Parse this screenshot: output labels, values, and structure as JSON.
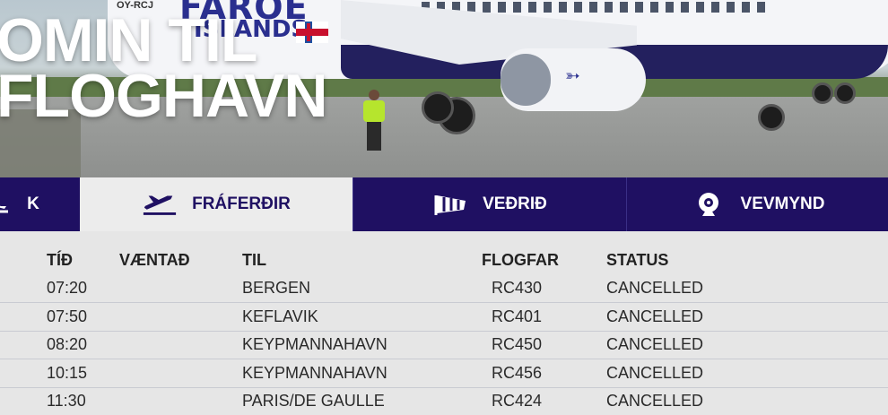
{
  "hero": {
    "title_line1": "OMIN TIL",
    "title_line2": "FLOGHAVN",
    "plane_brand_line1": "FAROE",
    "plane_brand_line2": "ISLANDS",
    "plane_registration": "OY-RCJ"
  },
  "nav": {
    "tabs": [
      {
        "label": "K",
        "icon": "landing-plane-icon",
        "active": false
      },
      {
        "label": "FRÁFERÐIR",
        "icon": "departing-plane-icon",
        "active": true
      },
      {
        "label": "VEÐRIÐ",
        "icon": "windsock-icon",
        "active": false
      },
      {
        "label": "VEVMYND",
        "icon": "webcam-icon",
        "active": false
      }
    ]
  },
  "table": {
    "headers": {
      "time": "TÍÐ",
      "expected": "VÆNTAÐ",
      "to": "TIL",
      "flight": "FLOGFAR",
      "status": "STATUS"
    },
    "rows": [
      {
        "time": "07:20",
        "expected": "",
        "to": "BERGEN",
        "flight": "RC430",
        "status": "CANCELLED"
      },
      {
        "time": "07:50",
        "expected": "",
        "to": "KEFLAVIK",
        "flight": "RC401",
        "status": "CANCELLED"
      },
      {
        "time": "08:20",
        "expected": "",
        "to": "KEYPMANNAHAVN",
        "flight": "RC450",
        "status": "CANCELLED"
      },
      {
        "time": "10:15",
        "expected": "",
        "to": "KEYPMANNAHAVN",
        "flight": "RC456",
        "status": "CANCELLED"
      },
      {
        "time": "11:30",
        "expected": "",
        "to": "PARIS/DE GAULLE",
        "flight": "RC424",
        "status": "CANCELLED"
      }
    ]
  },
  "colors": {
    "nav_bg": "#1f1062",
    "active_tab_bg": "#ececec",
    "table_bg": "#e6e6e6"
  }
}
